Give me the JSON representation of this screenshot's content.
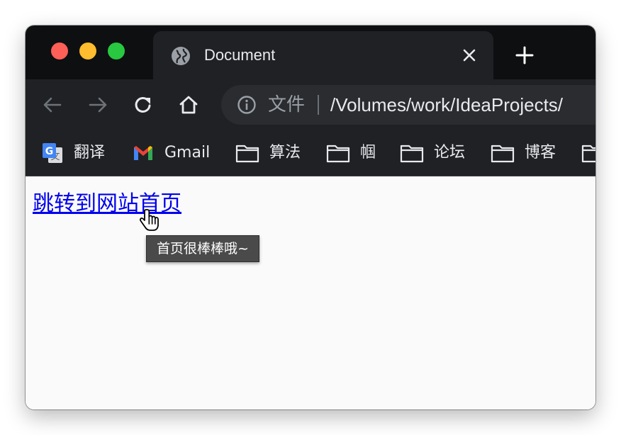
{
  "window": {
    "controls": [
      "close",
      "minimize",
      "maximize"
    ]
  },
  "tab": {
    "title": "Document",
    "favicon": "globe-icon",
    "close_icon": "close-icon"
  },
  "new_tab_icon": "plus-icon",
  "toolbar": {
    "back_icon": "arrow-left-icon",
    "forward_icon": "arrow-right-icon",
    "reload_icon": "reload-icon",
    "home_icon": "home-icon"
  },
  "omnibox": {
    "info_icon": "info-icon",
    "scheme_label": "文件",
    "url": "/Volumes/work/IdeaProjects/"
  },
  "bookmarks": [
    {
      "label": "翻译",
      "icon": "google-translate-icon"
    },
    {
      "label": "Gmail",
      "icon": "gmail-icon"
    },
    {
      "label": "算法",
      "icon": "folder-icon"
    },
    {
      "label": "帼",
      "icon": "folder-icon"
    },
    {
      "label": "论坛",
      "icon": "folder-icon"
    },
    {
      "label": "博客",
      "icon": "folder-icon"
    },
    {
      "label": "",
      "icon": "folder-icon"
    }
  ],
  "page": {
    "link_text": "跳转到网站首页",
    "tooltip": "首页很棒棒哦~"
  },
  "colors": {
    "tabstrip_bg": "#0e0f11",
    "toolbar_bg": "#1f2125",
    "link": "#0000ee",
    "close_light": "#fe5f57",
    "minimize_light": "#febc2e",
    "maximize_light": "#28c840"
  }
}
